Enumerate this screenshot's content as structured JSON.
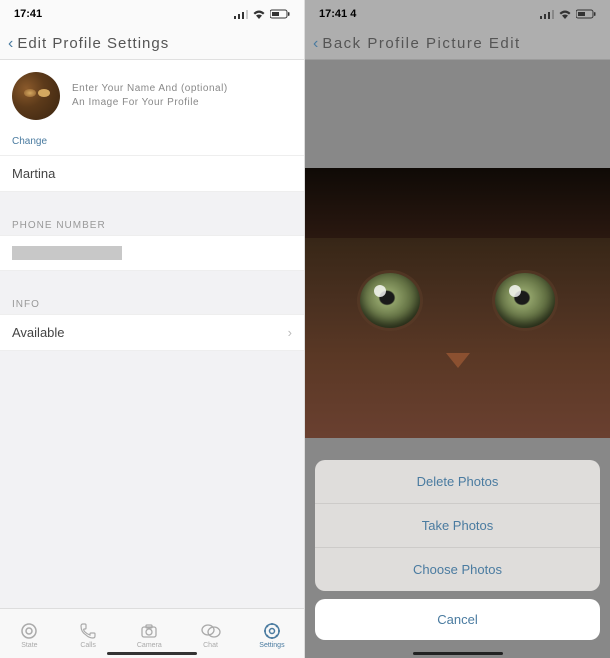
{
  "left": {
    "status": {
      "time": "17:41"
    },
    "nav": {
      "back": "‹",
      "title": "Edit Profile Settings"
    },
    "profile": {
      "hint_line1": "Enter Your Name And (optional)",
      "hint_line2": "An Image For Your Profile",
      "change": "Change",
      "name": "Martina"
    },
    "phone": {
      "label": "PHONE NUMBER"
    },
    "info": {
      "label": "INFO",
      "value": "Available"
    },
    "tabs": [
      {
        "label": "State",
        "icon": "circle-icon"
      },
      {
        "label": "Calls",
        "icon": "phone-icon"
      },
      {
        "label": "Camera",
        "icon": "camera-icon"
      },
      {
        "label": "Chat",
        "icon": "chat-icon"
      },
      {
        "label": "Settings",
        "icon": "gear-icon"
      }
    ]
  },
  "right": {
    "status": {
      "time": "17:41 4"
    },
    "nav": {
      "back": "‹",
      "title": "Back Profile Picture Edit"
    },
    "actions": {
      "delete": "Delete Photos",
      "take": "Take Photos",
      "choose": "Choose Photos",
      "cancel": "Cancel"
    }
  }
}
